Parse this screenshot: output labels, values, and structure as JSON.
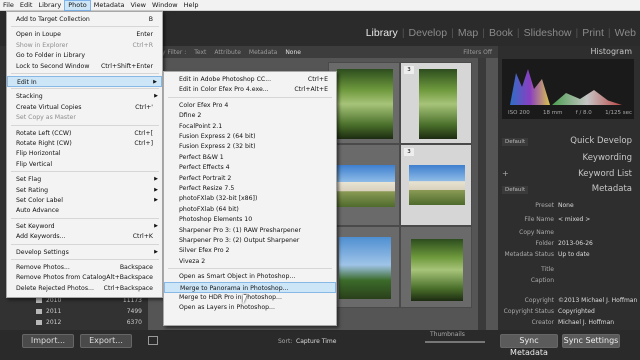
{
  "menubar": [
    "File",
    "Edit",
    "Library",
    "Photo",
    "Metadata",
    "View",
    "Window",
    "Help"
  ],
  "modules": [
    "Library",
    "Develop",
    "Map",
    "Book",
    "Slideshow",
    "Print",
    "Web"
  ],
  "filterbar": {
    "title": "y Filter :",
    "items": [
      "Text",
      "Attribute",
      "Metadata"
    ],
    "selected": "None",
    "off": "Filters Off"
  },
  "photo_menu": [
    {
      "label": "Add to Target Collection",
      "sc": "B"
    },
    {
      "sep": true
    },
    {
      "label": "Open in Loupe",
      "sc": "Enter"
    },
    {
      "label": "Show in Explorer",
      "sc": "Ctrl+R",
      "dis": true
    },
    {
      "label": "Go to Folder in Library"
    },
    {
      "label": "Lock to Second Window",
      "sc": "Ctrl+Shift+Enter"
    },
    {
      "sep": true
    },
    {
      "label": "Edit In",
      "arr": true,
      "hl": true
    },
    {
      "sep": true
    },
    {
      "label": "Stacking",
      "arr": true
    },
    {
      "label": "Create Virtual Copies",
      "sc": "Ctrl+'"
    },
    {
      "label": "Set Copy as Master",
      "dis": true
    },
    {
      "sep": true
    },
    {
      "label": "Rotate Left (CCW)",
      "sc": "Ctrl+["
    },
    {
      "label": "Rotate Right (CW)",
      "sc": "Ctrl+]"
    },
    {
      "label": "Flip Horizontal"
    },
    {
      "label": "Flip Vertical"
    },
    {
      "sep": true
    },
    {
      "label": "Set Flag",
      "arr": true
    },
    {
      "label": "Set Rating",
      "arr": true
    },
    {
      "label": "Set Color Label",
      "arr": true
    },
    {
      "label": "Auto Advance"
    },
    {
      "sep": true
    },
    {
      "label": "Set Keyword",
      "arr": true
    },
    {
      "label": "Add Keywords...",
      "sc": "Ctrl+K"
    },
    {
      "sep": true
    },
    {
      "label": "Develop Settings",
      "arr": true
    },
    {
      "sep": true
    },
    {
      "label": "Remove Photos...",
      "sc": "Backspace"
    },
    {
      "label": "Remove Photos from Catalog",
      "sc": "Alt+Backspace"
    },
    {
      "label": "Delete Rejected Photos...",
      "sc": "Ctrl+Backspace"
    }
  ],
  "edit_in_menu": [
    {
      "label": "Edit in Adobe Photoshop CC...",
      "sc": "Ctrl+E"
    },
    {
      "label": "Edit in Color Efex Pro 4.exe...",
      "sc": "Ctrl+Alt+E"
    },
    {
      "sep": true
    },
    {
      "label": "Color Efex Pro 4"
    },
    {
      "label": "Dfine 2"
    },
    {
      "label": "FocalPoint 2.1"
    },
    {
      "label": "Fusion Express 2 (64 bit)"
    },
    {
      "label": "Fusion Express 2 (32 bit)"
    },
    {
      "label": "Perfect B&W 1"
    },
    {
      "label": "Perfect Effects 4"
    },
    {
      "label": "Perfect Portrait 2"
    },
    {
      "label": "Perfect Resize 7.5"
    },
    {
      "label": "photoFXlab (32-bit [x86])"
    },
    {
      "label": "photoFXlab (64 bit)"
    },
    {
      "label": "Photoshop Elements 10"
    },
    {
      "label": "Sharpener Pro 3: (1) RAW Presharpener"
    },
    {
      "label": "Sharpener Pro 3: (2) Output Sharpener"
    },
    {
      "label": "Silver Efex Pro 2"
    },
    {
      "label": "Viveza 2"
    },
    {
      "sep": true
    },
    {
      "label": "Open as Smart Object in Photoshop..."
    },
    {
      "label": "Merge to Panorama in Photoshop...",
      "hl": true
    },
    {
      "label": "Merge to HDR Pro in Photoshop..."
    },
    {
      "label": "Open as Layers in Photoshop..."
    }
  ],
  "right": {
    "histogram": "Histogram",
    "histo_info": [
      "ISO 200",
      "18 mm",
      "f / 8.0",
      "1/125 sec"
    ],
    "quick_develop": "Quick Develop",
    "keywording": "Keywording",
    "keyword_list": "Keyword List",
    "metadata": "Metadata",
    "default": "Default",
    "preset_label": "Preset",
    "preset_value": "None",
    "fields": [
      {
        "label": "File Name",
        "value": "< mixed >"
      },
      {
        "label": "Copy Name",
        "value": ""
      },
      {
        "label": "Folder",
        "value": "2013-06-26"
      },
      {
        "label": "Metadata Status",
        "value": "Up to date"
      },
      {
        "label": "Title",
        "value": ""
      },
      {
        "label": "Caption",
        "value": ""
      },
      {
        "label": "Copyright",
        "value": "©2013 Michael J. Hoffman"
      },
      {
        "label": "Copyright Status",
        "value": "Copyrighted"
      },
      {
        "label": "Creator",
        "value": "Michael J. Hoffman"
      }
    ]
  },
  "folders": [
    {
      "name": "2010",
      "count": "11173"
    },
    {
      "name": "2011",
      "count": "7499"
    },
    {
      "name": "2012",
      "count": "6370"
    }
  ],
  "bottom": {
    "import": "Import...",
    "export": "Export...",
    "sort_label": "Sort:",
    "sort_value": "Capture Time",
    "thumbs": "Thumbnails",
    "sync_meta": "Sync Metadata",
    "sync_settings": "Sync Settings"
  },
  "grid_numbers": [
    "3",
    "3"
  ]
}
